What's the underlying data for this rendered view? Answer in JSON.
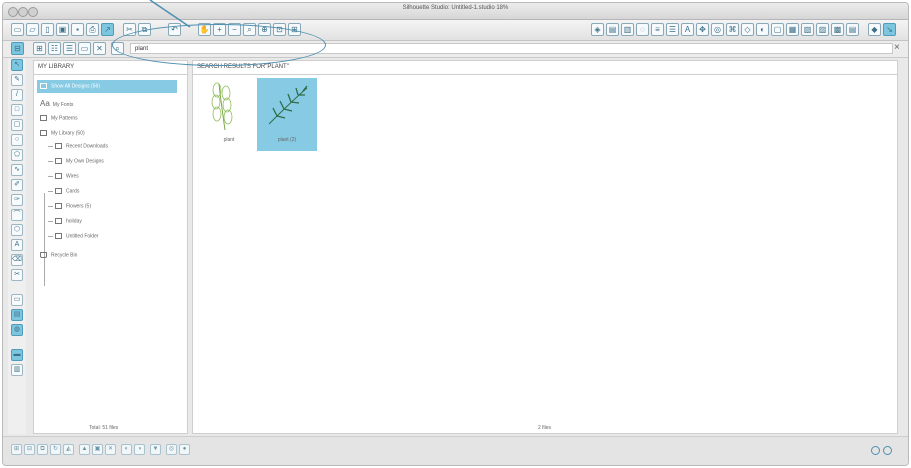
{
  "window": {
    "title": "Silhouette Studio: Untitled-1.studio 18%"
  },
  "search": {
    "value": "plant",
    "clear_label": "×"
  },
  "library": {
    "header": "MY LIBRARY",
    "items": [
      {
        "label": "Show All Designs (56)"
      },
      {
        "label": "My Fonts"
      },
      {
        "label": "My Patterns"
      },
      {
        "label": "My Library (50)"
      },
      {
        "label": "Recent Downloads"
      },
      {
        "label": "My Own Designs"
      },
      {
        "label": "Wires"
      },
      {
        "label": "Cards"
      },
      {
        "label": "Flowers (5)"
      },
      {
        "label": "holiday"
      },
      {
        "label": "Untitled Folder"
      },
      {
        "label": "Recycle Bin"
      }
    ],
    "total": "Total: 51 files"
  },
  "results": {
    "header": "SEARCH RESULTS FOR\"PLANT\"",
    "items": [
      {
        "caption": "plant"
      },
      {
        "caption": "plant (2)"
      }
    ],
    "count": "2 files"
  },
  "colors": {
    "accent": "#86cbe3",
    "annotation": "#4f8fb0"
  }
}
